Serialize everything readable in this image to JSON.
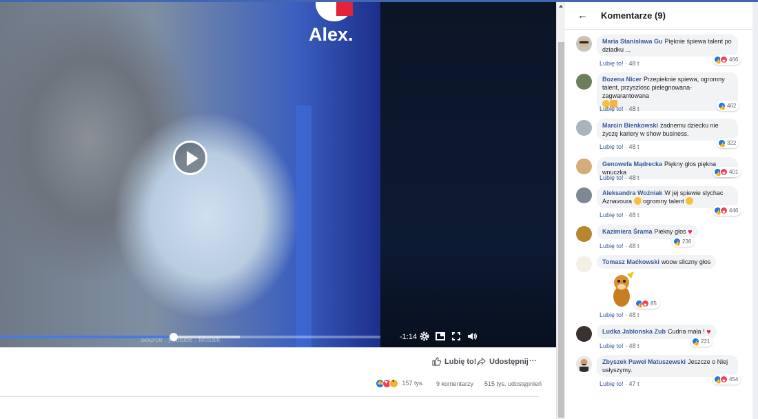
{
  "video": {
    "logo_text": "Alex.",
    "source_text": "Source : youtube : Mosaik",
    "time_remaining": "-1:14",
    "progress": 0.457,
    "buffered": 0.63,
    "icons": [
      "play-icon",
      "gear-icon",
      "miniplayer-icon",
      "fullscreen-icon",
      "volume-icon"
    ]
  },
  "actions": {
    "like_label": "Lubię to!",
    "share_label": "Udostępnij",
    "more_label": "···"
  },
  "stats": {
    "reactions_count": "157 tys.",
    "comments_count": "9 komentarzy",
    "shares_count": "515 tys. udostępnień"
  },
  "panel": {
    "title": "Komentarze (9)"
  },
  "comments": [
    {
      "author": "Maria Stanisława Gu",
      "text": "Pięknie śpiewa talent po dziadku ...",
      "like": "Lubię to!",
      "age": "48 t",
      "reactions": "466",
      "types": [
        "like",
        "love"
      ]
    },
    {
      "author": "Bozena Nicer",
      "text": "Przepieknie spiewa, ogromny talent, przyszlosc pielegnowana- zagwarantowana",
      "like": "Lubię to!",
      "age": "48 t",
      "reactions": "462",
      "types": [
        "like"
      ]
    },
    {
      "author": "Marcin Bienkowski",
      "text": "żadnemu dziecku nie życzę kariery w show business.",
      "like": "Lubię to!",
      "age": "48 t",
      "reactions": "322",
      "types": [
        "like"
      ]
    },
    {
      "author": "Genowefa Mądrecka",
      "text": "Piękny głos piękna wnuczka",
      "like": "Lubię to!",
      "age": "48 t",
      "reactions": "401",
      "types": [
        "like",
        "love"
      ]
    },
    {
      "author": "Aleksandra Woźniak",
      "text": "W jej spiewie slychac Aznavoura",
      "text2": "ogromny talent",
      "like": "Lubię to!",
      "age": "48 t",
      "reactions": "446",
      "types": [
        "like",
        "love"
      ]
    },
    {
      "author": "Kazimiera Śrama",
      "text": "Piekny głos",
      "like": "Lubię to!",
      "age": "48 t",
      "reactions": "236",
      "types": [
        "like"
      ]
    },
    {
      "author": "Tomasz Maćkowski",
      "text": "woow sliczny głos",
      "like": "Lubię to!",
      "age": "48 t",
      "reactions": "85",
      "types": [
        "like",
        "love"
      ]
    },
    {
      "author": "Ludka Jablonska Zub",
      "text": "Cudna mała !",
      "like": "Lubię to!",
      "age": "48 t",
      "reactions": "221",
      "types": [
        "like"
      ]
    },
    {
      "author": "Zbyszek Paweł Matuszewski",
      "text": "Jeszcze o Niej usłyszymy.",
      "like": "Lubię to!",
      "age": "47 t",
      "reactions": "454",
      "types": [
        "like",
        "love"
      ]
    }
  ],
  "colors": {
    "brand_blue": "#4267b2",
    "link": "#385898",
    "progress": "#4a7ae0",
    "like": "#1877f2",
    "love": "#f33e58"
  }
}
